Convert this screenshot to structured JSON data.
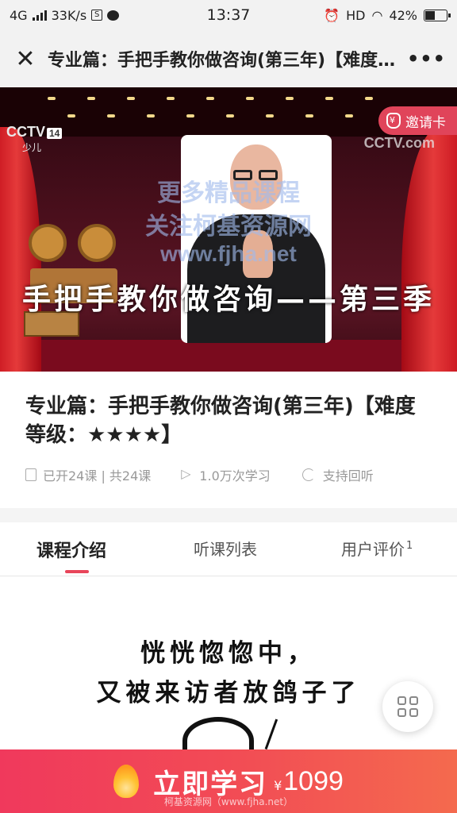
{
  "status_bar": {
    "network": "4G",
    "speed": "33K/s",
    "s_icon_letter": "S",
    "time": "13:37",
    "hd": "HD",
    "battery": "42%"
  },
  "title_bar": {
    "title": "专业篇：手把手教你做咨询(第三年)【难度等级：★★★★】"
  },
  "video": {
    "channel_left": "CCTV",
    "channel_left_num": "14",
    "channel_left_sub": "少儿",
    "channel_right": "CCTV.com",
    "invite_label": "邀请卡",
    "watermark_1": "更多精品课程",
    "watermark_2": "关注柯基资源网",
    "watermark_3": "www.fjha.net",
    "overlay_title": "手把手教你做咨询——第三季"
  },
  "course": {
    "name": "专业篇：手把手教你做咨询(第三年)【难度等级：★★★★】",
    "lessons": "已开24课 | 共24课",
    "views": "1.0万次学习",
    "replay": "支持回听"
  },
  "tabs": [
    {
      "label": "课程介绍",
      "active": true
    },
    {
      "label": "听课列表",
      "active": false
    },
    {
      "label": "用户评价",
      "badge": "1",
      "active": false
    }
  ],
  "intro": {
    "line1": "恍恍惚惚中，",
    "line2": "又被来访者放鸽子了"
  },
  "buy_bar": {
    "label": "立即学习",
    "currency": "¥",
    "price": "1099",
    "watermark": "柯基资源网（www.fjha.net）"
  },
  "colors": {
    "accent": "#e8455a",
    "buy_gradient_start": "#f0395c",
    "buy_gradient_end": "#f46a4e"
  }
}
